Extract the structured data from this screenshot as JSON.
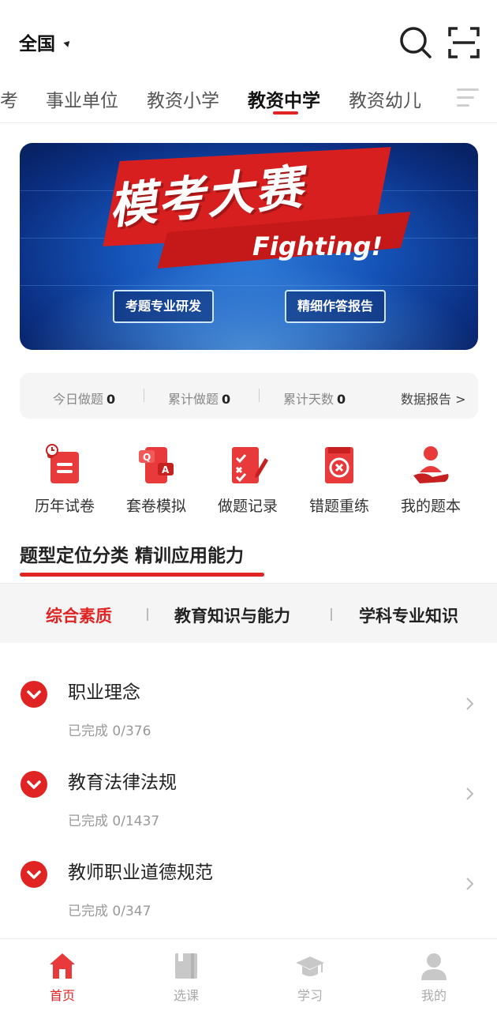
{
  "header": {
    "region": "全国"
  },
  "tabs": [
    {
      "label": "考"
    },
    {
      "label": "事业单位"
    },
    {
      "label": "教资小学"
    },
    {
      "label": "教资中学",
      "active": true
    },
    {
      "label": "教资幼儿"
    }
  ],
  "banner": {
    "title": "模考大赛",
    "slogan": "Fighting!",
    "tag_left": "考题专业研发",
    "tag_right": "精细作答报告"
  },
  "stats": {
    "today_label": "今日做题",
    "today_value": "0",
    "total_label": "累计做题",
    "total_value": "0",
    "days_label": "累计天数",
    "days_value": "0",
    "report_label": "数据报告 >"
  },
  "shortcuts": [
    {
      "label": "历年试卷",
      "icon": "scroll-clock-icon"
    },
    {
      "label": "套卷模拟",
      "icon": "qa-phone-icon"
    },
    {
      "label": "做题记录",
      "icon": "checklist-pen-icon"
    },
    {
      "label": "错题重练",
      "icon": "retry-book-icon"
    },
    {
      "label": "我的题本",
      "icon": "person-hand-icon"
    }
  ],
  "section": {
    "title": "题型定位分类 精训应用能力"
  },
  "subtabs": [
    {
      "label": "综合素质",
      "active": true
    },
    {
      "label": "教育知识与能力"
    },
    {
      "label": "学科专业知识"
    }
  ],
  "items": [
    {
      "name": "职业理念",
      "progress": "已完成 0/376"
    },
    {
      "name": "教育法律法规",
      "progress": "已完成 0/1437"
    },
    {
      "name": "教师职业道德规范",
      "progress": "已完成 0/347"
    }
  ],
  "nav": [
    {
      "label": "首页",
      "icon": "home-icon",
      "active": true
    },
    {
      "label": "选课",
      "icon": "book-icon"
    },
    {
      "label": "学习",
      "icon": "graduation-cap-icon"
    },
    {
      "label": "我的",
      "icon": "user-icon"
    }
  ],
  "colors": {
    "accent": "#e02424",
    "muted": "#999999",
    "bg_gray": "#f5f5f5"
  }
}
